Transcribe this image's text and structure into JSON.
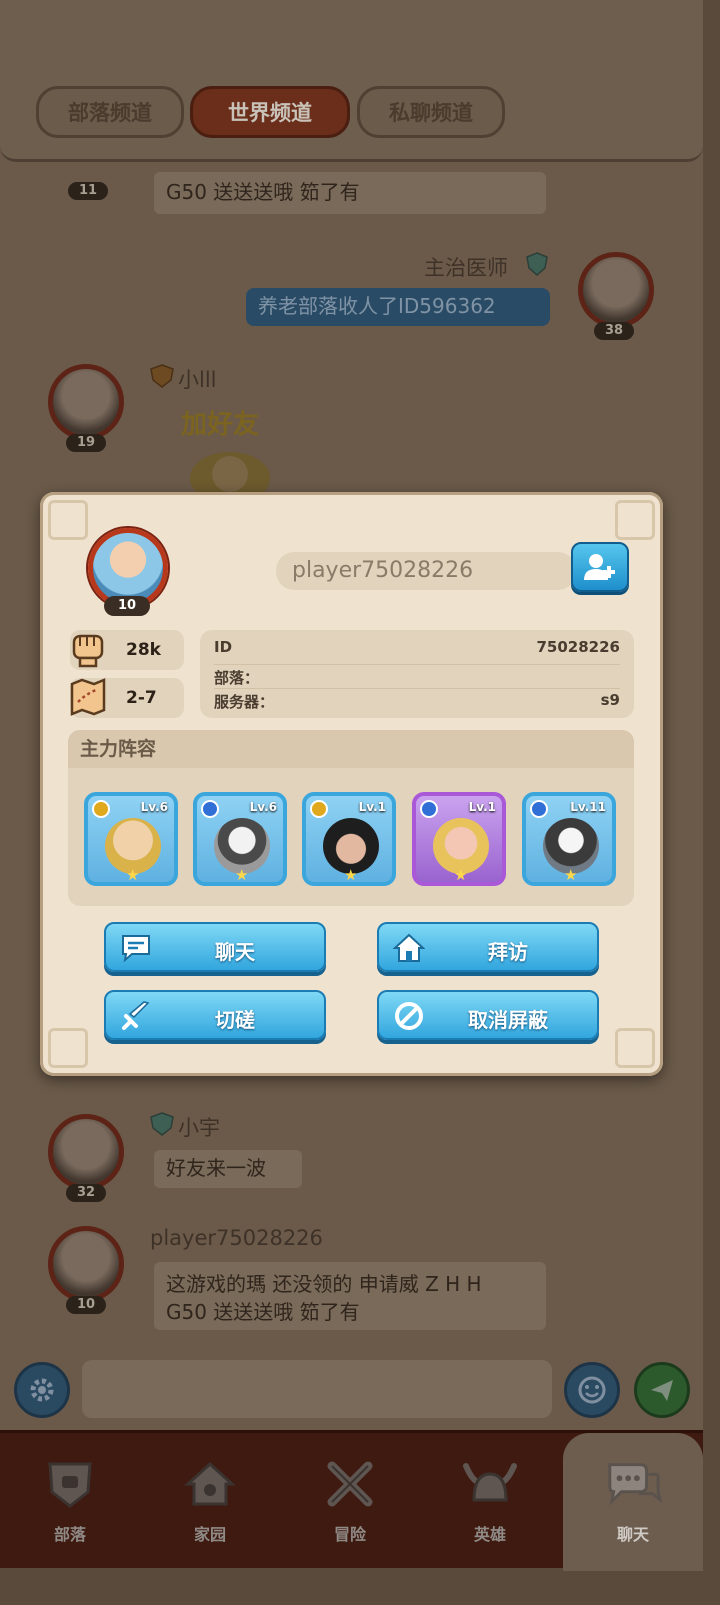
{
  "tabs": [
    {
      "label": "部落频道",
      "active": false
    },
    {
      "label": "世界频道",
      "active": true
    },
    {
      "label": "私聊频道",
      "active": false
    }
  ],
  "chat": {
    "messages": [
      {
        "text": "G50 送送送哦  筎了有",
        "level": "11"
      },
      {
        "name": "主治医师",
        "text": "养老部落收人了ID596362",
        "level": "38"
      },
      {
        "name": "小lll",
        "sticker": "加好友",
        "level": "19"
      },
      {
        "name": "小宇",
        "text": "好友来一波",
        "level": "32"
      },
      {
        "name": "player75028226",
        "text_line1": "这游戏的瑪 还没领的 申请威  Z H H",
        "text_line2": "G50 送送送哦  筎了有",
        "level": "10"
      }
    ]
  },
  "profile": {
    "level": "10",
    "username": "player75028226",
    "power": "28k",
    "progress": "2-7",
    "id_label": "ID",
    "id_value": "75028226",
    "tribe_label": "部落：",
    "tribe_value": "",
    "server_label": "服务器：",
    "server_value": "s9",
    "lineup_title": "主力阵容",
    "heroes": [
      {
        "lv": "Lv.6",
        "element": "gold",
        "rarity": "blue"
      },
      {
        "lv": "Lv.6",
        "element": "blue",
        "rarity": "blue"
      },
      {
        "lv": "Lv.1",
        "element": "gold",
        "rarity": "blue"
      },
      {
        "lv": "Lv.1",
        "element": "blue",
        "rarity": "purple"
      },
      {
        "lv": "Lv.11",
        "element": "blue",
        "rarity": "blue"
      }
    ],
    "buttons": {
      "chat": "聊天",
      "visit": "拜访",
      "duel": "切磋",
      "unblock": "取消屏蔽"
    }
  },
  "nav": [
    {
      "label": "部落",
      "icon": "tribe-shield-icon"
    },
    {
      "label": "家园",
      "icon": "home-icon"
    },
    {
      "label": "冒险",
      "icon": "crossed-swords-icon"
    },
    {
      "label": "英雄",
      "icon": "viking-helmet-icon"
    },
    {
      "label": "聊天",
      "icon": "chat-bubbles-icon",
      "active": true
    }
  ],
  "colors": {
    "accent_blue": "#32a6de",
    "modal_bg": "#efe3d0",
    "active_tab": "#6a2e1a"
  }
}
